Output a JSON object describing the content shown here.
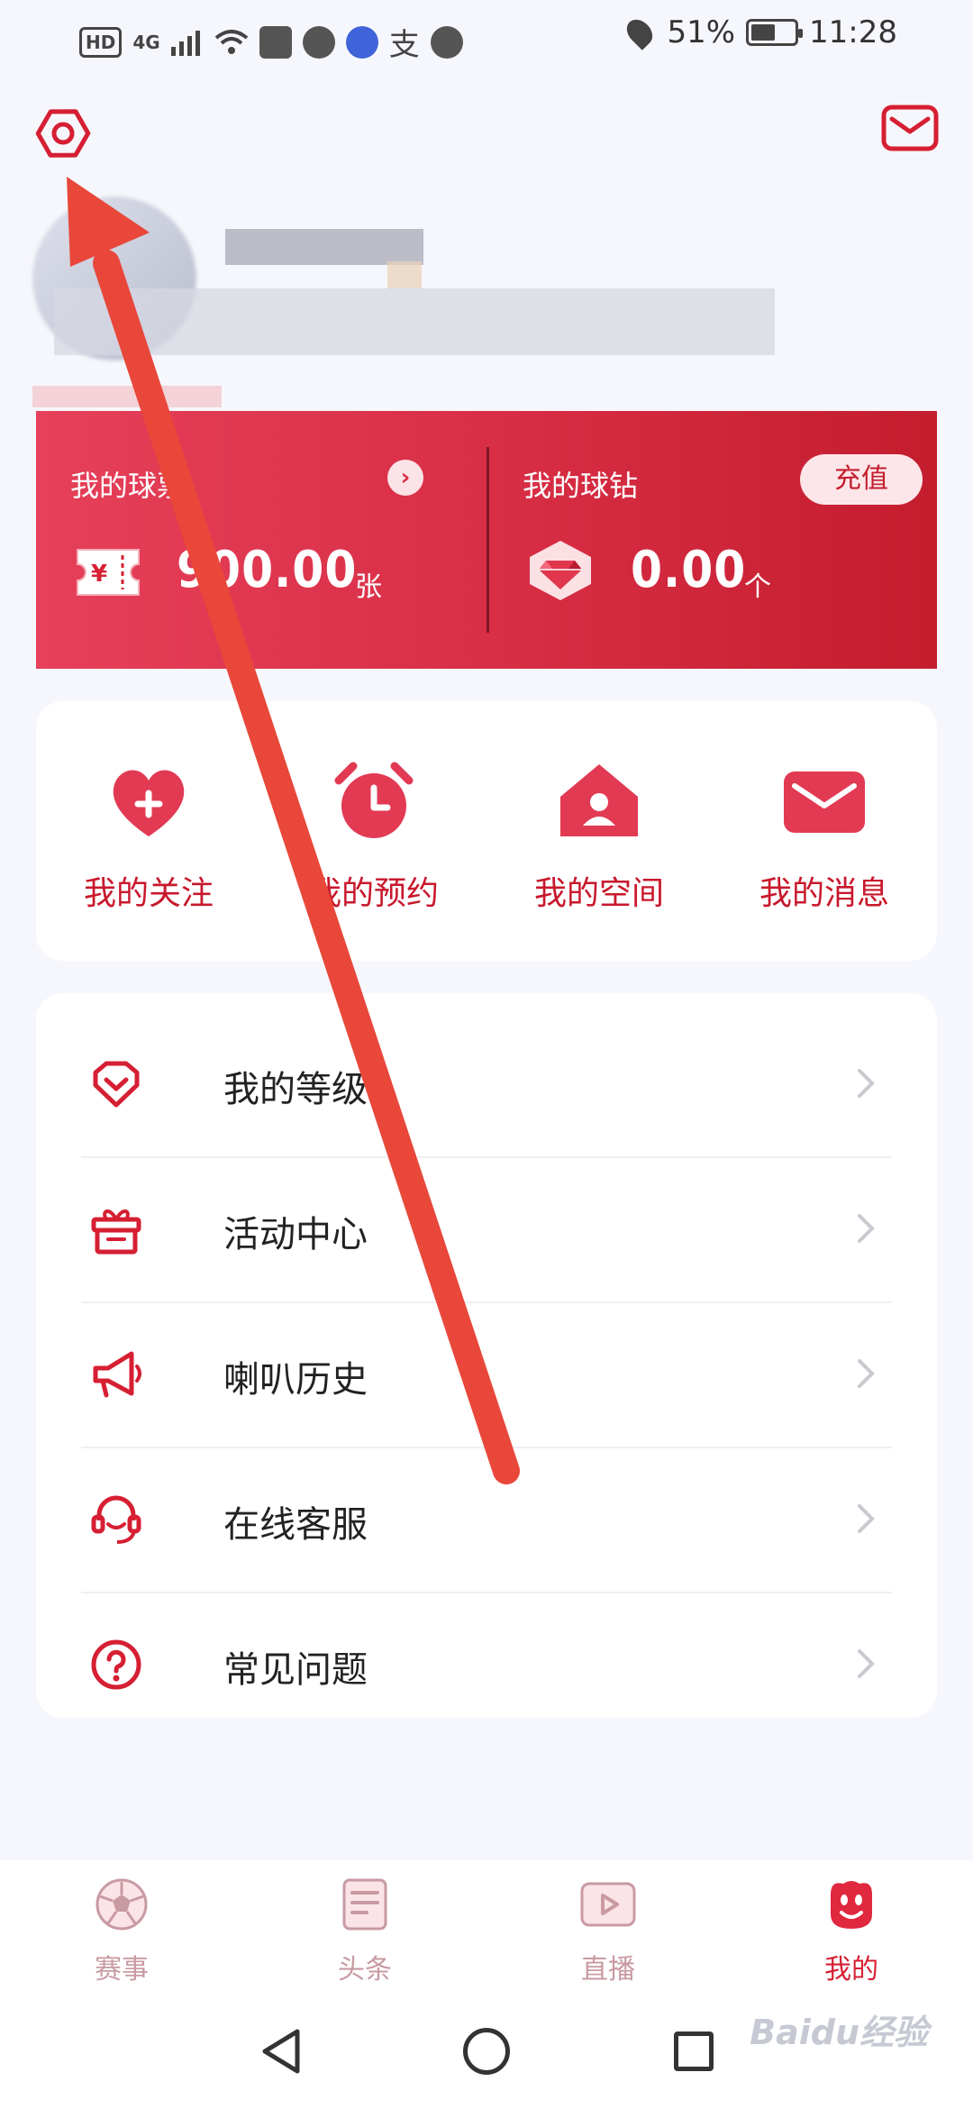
{
  "status_bar": {
    "hd": "HD",
    "network": "4G",
    "battery": "51%",
    "time": "11:28"
  },
  "header": {
    "settings_icon": "hexagon-settings-icon",
    "mail_icon": "envelope-icon"
  },
  "wallet": {
    "tickets_label": "我的球票",
    "tickets_value": "900.00",
    "tickets_unit": "张",
    "diamonds_label": "我的球钻",
    "diamonds_value": "0.00",
    "diamonds_unit": "个",
    "recharge": "充值"
  },
  "quick_actions": [
    {
      "label": "我的关注",
      "icon": "heart-plus-icon"
    },
    {
      "label": "我的预约",
      "icon": "alarm-clock-icon"
    },
    {
      "label": "我的空间",
      "icon": "house-user-icon"
    },
    {
      "label": "我的消息",
      "icon": "envelope-icon"
    }
  ],
  "menu": [
    {
      "label": "我的等级",
      "icon": "level-heart-icon"
    },
    {
      "label": "活动中心",
      "icon": "gift-icon"
    },
    {
      "label": "喇叭历史",
      "icon": "megaphone-icon"
    },
    {
      "label": "在线客服",
      "icon": "headset-icon"
    },
    {
      "label": "常见问题",
      "icon": "question-icon"
    }
  ],
  "bottom_nav": [
    {
      "label": "赛事",
      "icon": "soccer-ball-icon",
      "active": false
    },
    {
      "label": "头条",
      "icon": "news-icon",
      "active": false
    },
    {
      "label": "直播",
      "icon": "play-icon",
      "active": false
    },
    {
      "label": "我的",
      "icon": "mascot-face-icon",
      "active": true
    }
  ],
  "watermark": "Baidu经验",
  "colors": {
    "accent": "#d61f33",
    "wallet_start": "#e6405a",
    "wallet_end": "#c41d2e",
    "background": "#f6f7fc",
    "annotation_arrow": "#e8473a"
  }
}
